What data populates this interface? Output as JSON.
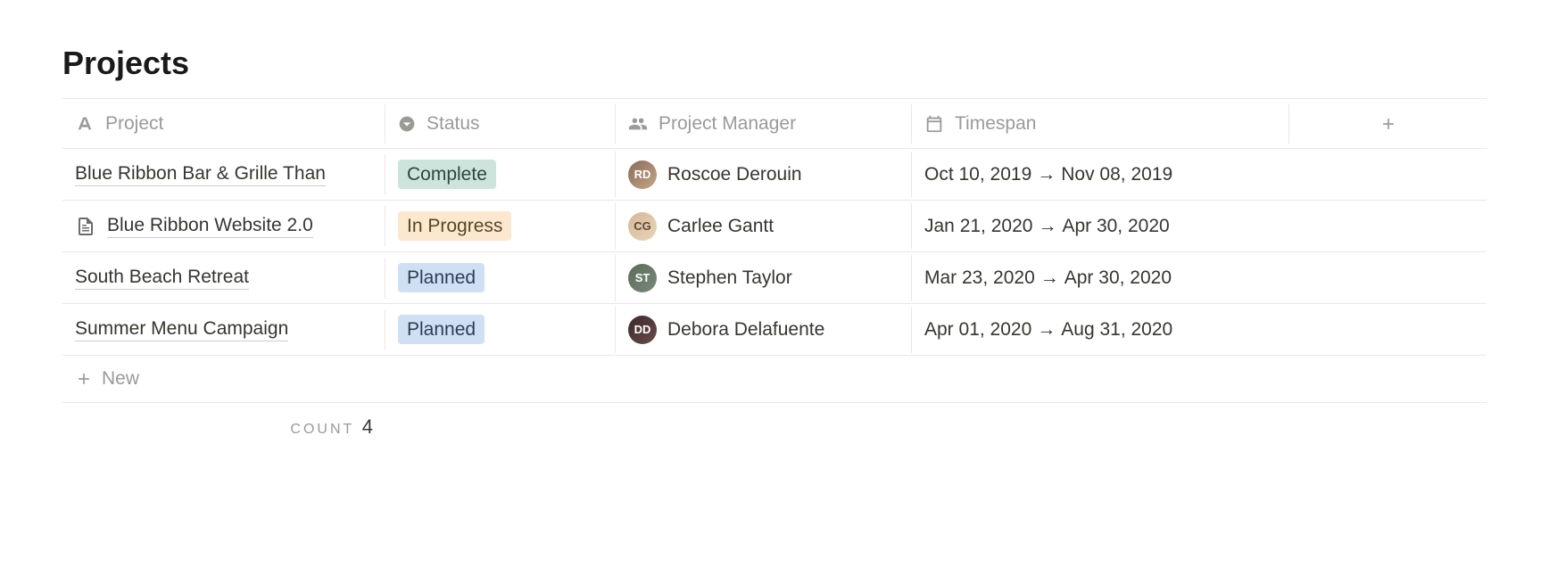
{
  "title": "Projects",
  "columns": {
    "project": "Project",
    "status": "Status",
    "manager": "Project Manager",
    "timespan": "Timespan"
  },
  "rows": [
    {
      "project": "Blue Ribbon Bar & Grille Than",
      "hasIcon": false,
      "status": "Complete",
      "statusClass": "tag-complete",
      "manager": "Roscoe Derouin",
      "avatarClass": "av1",
      "initials": "RD",
      "start": "Oct 10, 2019",
      "end": "Nov 08, 2019"
    },
    {
      "project": "Blue Ribbon Website 2.0",
      "hasIcon": true,
      "status": "In Progress",
      "statusClass": "tag-inprogress",
      "manager": "Carlee Gantt",
      "avatarClass": "av2",
      "initials": "CG",
      "start": "Jan 21, 2020",
      "end": "Apr 30, 2020"
    },
    {
      "project": "South Beach Retreat",
      "hasIcon": false,
      "status": "Planned",
      "statusClass": "tag-planned",
      "manager": "Stephen Taylor",
      "avatarClass": "av3",
      "initials": "ST",
      "start": "Mar 23, 2020",
      "end": "Apr 30, 2020"
    },
    {
      "project": "Summer Menu Campaign",
      "hasIcon": false,
      "status": "Planned",
      "statusClass": "tag-planned",
      "manager": "Debora Delafuente",
      "avatarClass": "av4",
      "initials": "DD",
      "start": "Apr 01, 2020",
      "end": "Aug 31, 2020"
    }
  ],
  "newLabel": "New",
  "count": {
    "label": "COUNT",
    "value": "4"
  }
}
